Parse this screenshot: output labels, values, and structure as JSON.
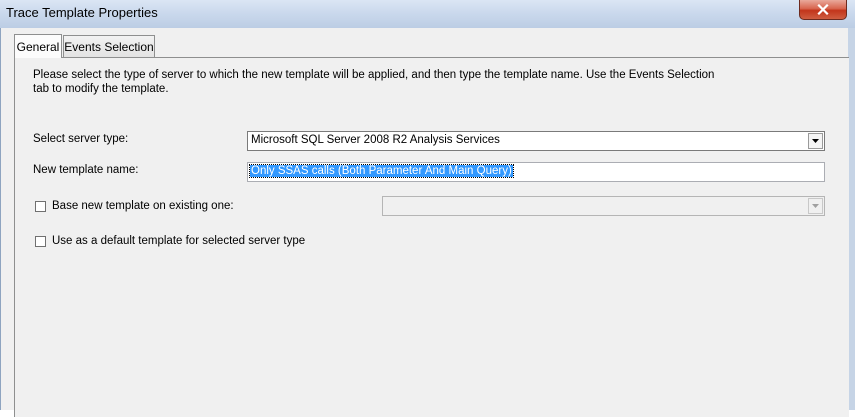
{
  "window": {
    "title": "Trace Template Properties"
  },
  "tabs": [
    {
      "label": "General",
      "active": true
    },
    {
      "label": "Events Selection",
      "active": false
    }
  ],
  "general": {
    "description": "Please select the type of server to which the new template will be applied, and then type the template name.  Use the Events Selection tab to modify the template.",
    "server_type_label": "Select server type:",
    "server_type_value": "Microsoft SQL Server 2008 R2 Analysis Services",
    "template_name_label": "New template name:",
    "template_name_value": "Only SSAS calls (Both Parameter And Main Query)",
    "base_template_label": "Base new template on existing one:",
    "base_template_checked": false,
    "base_template_value": "",
    "default_template_label": "Use as a default template for selected server type",
    "default_template_checked": false
  },
  "colors": {
    "selection": "#3399ff",
    "close_button": "#c2351b"
  }
}
